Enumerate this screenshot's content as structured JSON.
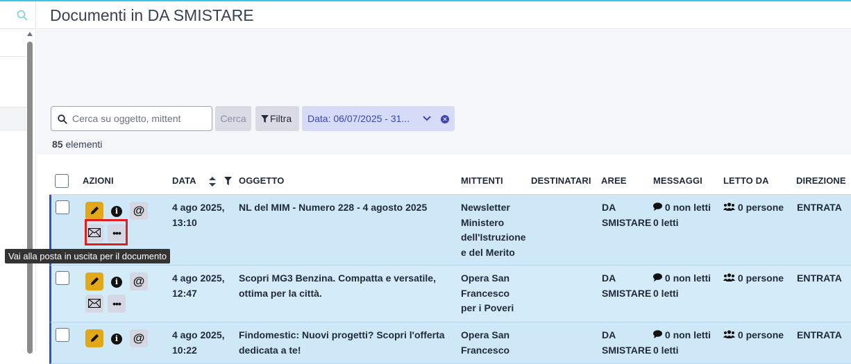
{
  "page": {
    "title": "Documenti in DA SMISTARE"
  },
  "toolbar": {
    "search_placeholder": "Cerca su oggetto, mittent",
    "search_value": "",
    "cerca_label": "Cerca",
    "filtra_label": "Filtra",
    "date_chip_label": "Data: 06/07/2025 - 31...",
    "count_number": "85",
    "count_label": "elementi"
  },
  "table": {
    "headers": {
      "azioni": "AZIONI",
      "data": "DATA",
      "oggetto": "OGGETTO",
      "mittenti": "MITTENTI",
      "destinatari": "DESTINATARI",
      "aree": "AREE",
      "messaggi": "MESSAGGI",
      "letto_da": "LETTO DA",
      "direzione": "DIREZIONE"
    },
    "rows": [
      {
        "date_line1": "4 ago 2025,",
        "date_line2": "13:10",
        "oggetto": "NL del MIM - Numero 228 - 4 agosto 2025",
        "mittenti": "Newsletter Ministero dell'Istruzione e del Merito",
        "aree_line1": "DA",
        "aree_line2": "SMISTARE",
        "messaggi_line1": "0 non letti",
        "messaggi_line2": "0 letti",
        "letto_da": "0 persone",
        "direzione": "ENTRATA"
      },
      {
        "date_line1": "4 ago 2025,",
        "date_line2": "12:47",
        "oggetto": "Scopri MG3 Benzina. Compatta e versatile, ottima per la città.",
        "mittenti": "Opera San Francesco per i Poveri",
        "aree_line1": "DA",
        "aree_line2": "SMISTARE",
        "messaggi_line1": "0 non letti",
        "messaggi_line2": "0 letti",
        "letto_da": "0 persone",
        "direzione": "ENTRATA"
      },
      {
        "date_line1": "4 ago 2025,",
        "date_line2": "10:22",
        "oggetto": "Findomestic: Nuovi progetti? Scopri l'offerta dedicata a te!",
        "mittenti": "Opera San Francesco",
        "aree_line1": "DA",
        "aree_line2": "SMISTARE",
        "messaggi_line1": "0 non letti",
        "messaggi_line2": "0 letti",
        "letto_da": "0 persone",
        "direzione": "ENTRATA"
      }
    ]
  },
  "tooltip": {
    "text": "Vai alla posta in uscita per il documento"
  },
  "icons": {
    "edit": "pencil-icon",
    "info": "info-icon",
    "email": "at-sign-icon",
    "outbox": "envelope-icon",
    "more": "ellipsis-icon",
    "messages": "comment-icon",
    "readers": "users-icon",
    "sort": "sort-icon",
    "filter": "filter-icon"
  },
  "colors": {
    "accent_top": "#38c6e6",
    "row_bg": "#cfe8f7",
    "row_border": "#3151c8",
    "edit_button": "#e3a817",
    "chip_bg": "#d6dcf8",
    "chip_text": "#3b45b5",
    "highlight": "#e01e1e"
  }
}
